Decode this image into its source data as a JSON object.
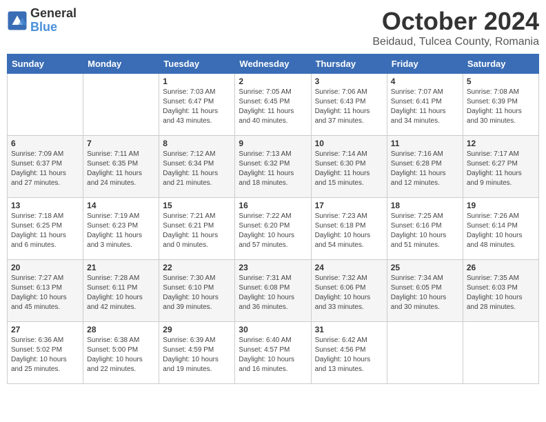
{
  "header": {
    "logo_general": "General",
    "logo_blue": "Blue",
    "month_title": "October 2024",
    "subtitle": "Beidaud, Tulcea County, Romania"
  },
  "days_of_week": [
    "Sunday",
    "Monday",
    "Tuesday",
    "Wednesday",
    "Thursday",
    "Friday",
    "Saturday"
  ],
  "weeks": [
    [
      {
        "day": "",
        "content": ""
      },
      {
        "day": "",
        "content": ""
      },
      {
        "day": "1",
        "content": "Sunrise: 7:03 AM\nSunset: 6:47 PM\nDaylight: 11 hours and 43 minutes."
      },
      {
        "day": "2",
        "content": "Sunrise: 7:05 AM\nSunset: 6:45 PM\nDaylight: 11 hours and 40 minutes."
      },
      {
        "day": "3",
        "content": "Sunrise: 7:06 AM\nSunset: 6:43 PM\nDaylight: 11 hours and 37 minutes."
      },
      {
        "day": "4",
        "content": "Sunrise: 7:07 AM\nSunset: 6:41 PM\nDaylight: 11 hours and 34 minutes."
      },
      {
        "day": "5",
        "content": "Sunrise: 7:08 AM\nSunset: 6:39 PM\nDaylight: 11 hours and 30 minutes."
      }
    ],
    [
      {
        "day": "6",
        "content": "Sunrise: 7:09 AM\nSunset: 6:37 PM\nDaylight: 11 hours and 27 minutes."
      },
      {
        "day": "7",
        "content": "Sunrise: 7:11 AM\nSunset: 6:35 PM\nDaylight: 11 hours and 24 minutes."
      },
      {
        "day": "8",
        "content": "Sunrise: 7:12 AM\nSunset: 6:34 PM\nDaylight: 11 hours and 21 minutes."
      },
      {
        "day": "9",
        "content": "Sunrise: 7:13 AM\nSunset: 6:32 PM\nDaylight: 11 hours and 18 minutes."
      },
      {
        "day": "10",
        "content": "Sunrise: 7:14 AM\nSunset: 6:30 PM\nDaylight: 11 hours and 15 minutes."
      },
      {
        "day": "11",
        "content": "Sunrise: 7:16 AM\nSunset: 6:28 PM\nDaylight: 11 hours and 12 minutes."
      },
      {
        "day": "12",
        "content": "Sunrise: 7:17 AM\nSunset: 6:27 PM\nDaylight: 11 hours and 9 minutes."
      }
    ],
    [
      {
        "day": "13",
        "content": "Sunrise: 7:18 AM\nSunset: 6:25 PM\nDaylight: 11 hours and 6 minutes."
      },
      {
        "day": "14",
        "content": "Sunrise: 7:19 AM\nSunset: 6:23 PM\nDaylight: 11 hours and 3 minutes."
      },
      {
        "day": "15",
        "content": "Sunrise: 7:21 AM\nSunset: 6:21 PM\nDaylight: 11 hours and 0 minutes."
      },
      {
        "day": "16",
        "content": "Sunrise: 7:22 AM\nSunset: 6:20 PM\nDaylight: 10 hours and 57 minutes."
      },
      {
        "day": "17",
        "content": "Sunrise: 7:23 AM\nSunset: 6:18 PM\nDaylight: 10 hours and 54 minutes."
      },
      {
        "day": "18",
        "content": "Sunrise: 7:25 AM\nSunset: 6:16 PM\nDaylight: 10 hours and 51 minutes."
      },
      {
        "day": "19",
        "content": "Sunrise: 7:26 AM\nSunset: 6:14 PM\nDaylight: 10 hours and 48 minutes."
      }
    ],
    [
      {
        "day": "20",
        "content": "Sunrise: 7:27 AM\nSunset: 6:13 PM\nDaylight: 10 hours and 45 minutes."
      },
      {
        "day": "21",
        "content": "Sunrise: 7:28 AM\nSunset: 6:11 PM\nDaylight: 10 hours and 42 minutes."
      },
      {
        "day": "22",
        "content": "Sunrise: 7:30 AM\nSunset: 6:10 PM\nDaylight: 10 hours and 39 minutes."
      },
      {
        "day": "23",
        "content": "Sunrise: 7:31 AM\nSunset: 6:08 PM\nDaylight: 10 hours and 36 minutes."
      },
      {
        "day": "24",
        "content": "Sunrise: 7:32 AM\nSunset: 6:06 PM\nDaylight: 10 hours and 33 minutes."
      },
      {
        "day": "25",
        "content": "Sunrise: 7:34 AM\nSunset: 6:05 PM\nDaylight: 10 hours and 30 minutes."
      },
      {
        "day": "26",
        "content": "Sunrise: 7:35 AM\nSunset: 6:03 PM\nDaylight: 10 hours and 28 minutes."
      }
    ],
    [
      {
        "day": "27",
        "content": "Sunrise: 6:36 AM\nSunset: 5:02 PM\nDaylight: 10 hours and 25 minutes."
      },
      {
        "day": "28",
        "content": "Sunrise: 6:38 AM\nSunset: 5:00 PM\nDaylight: 10 hours and 22 minutes."
      },
      {
        "day": "29",
        "content": "Sunrise: 6:39 AM\nSunset: 4:59 PM\nDaylight: 10 hours and 19 minutes."
      },
      {
        "day": "30",
        "content": "Sunrise: 6:40 AM\nSunset: 4:57 PM\nDaylight: 10 hours and 16 minutes."
      },
      {
        "day": "31",
        "content": "Sunrise: 6:42 AM\nSunset: 4:56 PM\nDaylight: 10 hours and 13 minutes."
      },
      {
        "day": "",
        "content": ""
      },
      {
        "day": "",
        "content": ""
      }
    ]
  ]
}
